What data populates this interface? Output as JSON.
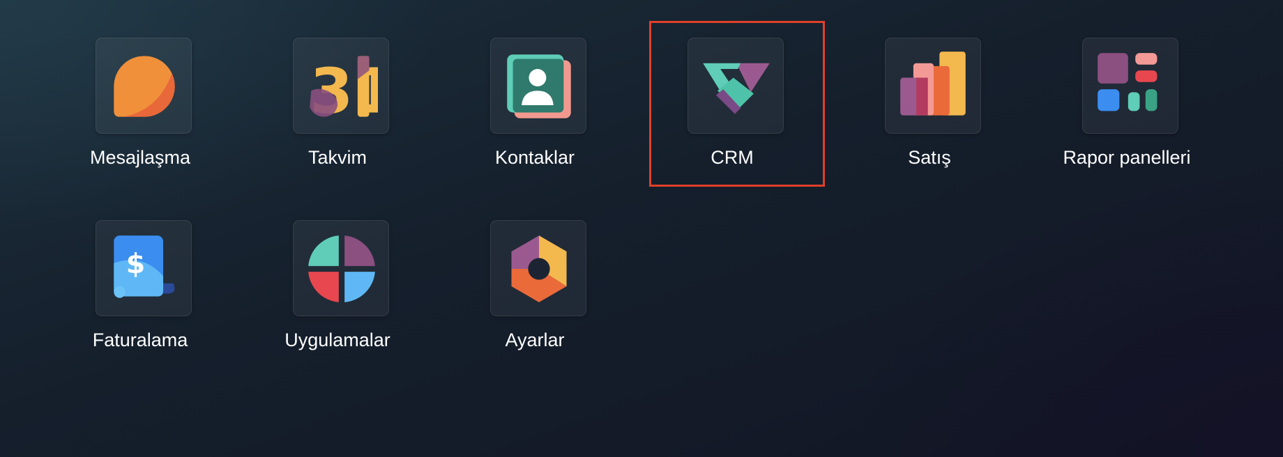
{
  "apps": [
    {
      "id": "messaging",
      "label": "Mesajlaşma",
      "icon": "messaging-icon"
    },
    {
      "id": "calendar",
      "label": "Takvim",
      "icon": "calendar-icon",
      "icon_text": "31"
    },
    {
      "id": "contacts",
      "label": "Kontaklar",
      "icon": "contacts-icon"
    },
    {
      "id": "crm",
      "label": "CRM",
      "icon": "crm-handshake-icon",
      "selected": true
    },
    {
      "id": "sales",
      "label": "Satış",
      "icon": "sales-chart-icon"
    },
    {
      "id": "dashboards",
      "label": "Rapor panelleri",
      "icon": "dashboards-icon"
    },
    {
      "id": "invoicing",
      "label": "Faturalama",
      "icon": "invoicing-icon",
      "icon_text": "$"
    },
    {
      "id": "apps",
      "label": "Uygulamalar",
      "icon": "apps-icon"
    },
    {
      "id": "settings",
      "label": "Ayarlar",
      "icon": "settings-hexagon-icon"
    }
  ],
  "colors": {
    "selection_border": "#e0402a",
    "label_text": "#ffffff"
  }
}
